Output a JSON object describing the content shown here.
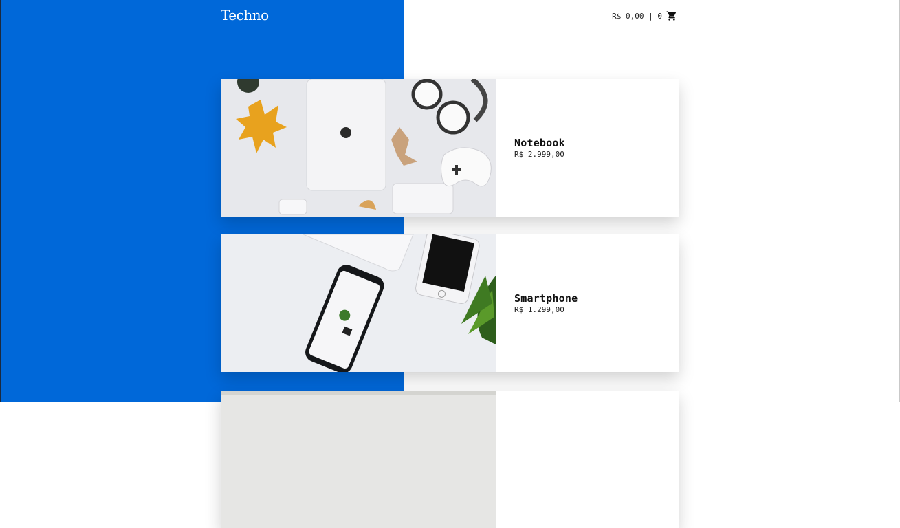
{
  "header": {
    "logo": "Techno",
    "cart_total": "R$ 0,00 | 0",
    "cart_icon": "shopping-cart-icon"
  },
  "colors": {
    "accent_blue": "#0068d9",
    "background": "#ffffff",
    "text": "#111111"
  },
  "products": [
    {
      "name": "Notebook",
      "price": "R$ 2.999,00",
      "image": "notebook-flatlay-image"
    },
    {
      "name": "Smartphone",
      "price": "R$ 1.299,00",
      "image": "smartphone-flatlay-image"
    },
    {
      "name": "",
      "price": "",
      "image": "partial-product-image"
    }
  ]
}
